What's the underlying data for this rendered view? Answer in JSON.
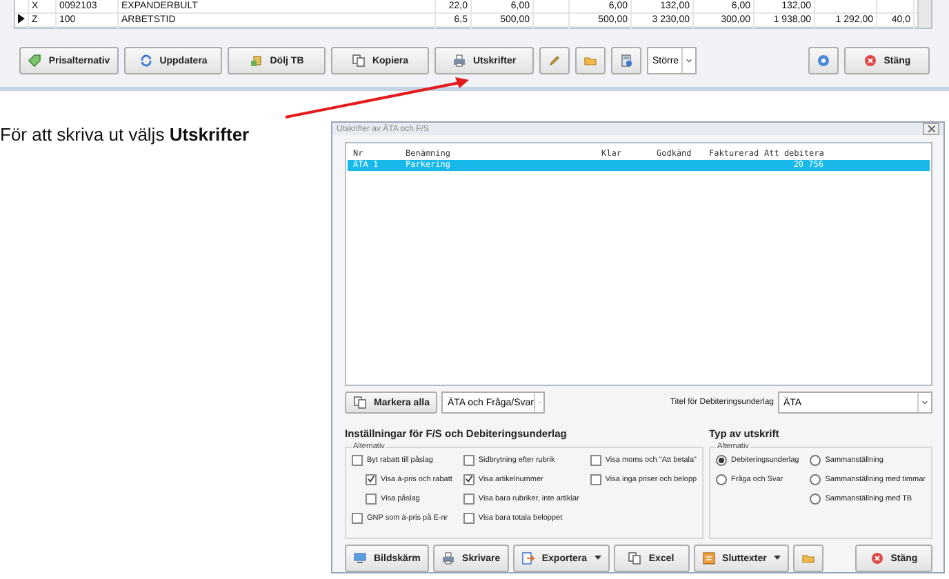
{
  "grid": {
    "rows": [
      {
        "current": false,
        "type": "X",
        "code": "0092103",
        "name": "EXPANDERBULT",
        "cells": [
          "22,0",
          "6,00",
          "",
          "6,00",
          "132,00",
          "6,00",
          "132,00",
          "",
          ""
        ]
      },
      {
        "current": true,
        "type": "Z",
        "code": "100",
        "name": "ARBETSTID",
        "cells": [
          "6,5",
          "500,00",
          "",
          "500,00",
          "3 230,00",
          "300,00",
          "1 938,00",
          "1 292,00",
          "40,0"
        ]
      }
    ]
  },
  "toolbar": {
    "buttons": [
      {
        "kind": "text",
        "label": "Prisalternativ"
      },
      {
        "kind": "text",
        "label": "Uppdatera"
      },
      {
        "kind": "text",
        "label": "Dölj TB"
      },
      {
        "kind": "text",
        "label": "Kopiera"
      },
      {
        "kind": "text",
        "label": "Utskrifter"
      },
      {
        "kind": "icon"
      },
      {
        "kind": "icon"
      },
      {
        "kind": "icon"
      }
    ],
    "size_select": "Större",
    "close": "Stäng"
  },
  "instruction": "För att skriva ut väljs **Utskrifter**",
  "dialog": {
    "title": "Utskrifter av ÄTA och F/S",
    "columns": [
      "Nr",
      "Benämning",
      "Klar",
      "Godkänd",
      "Fakturerad",
      "Att debitera"
    ],
    "rows": [
      {
        "selected": true,
        "cells": [
          "ÄTA 1",
          "Parkering",
          "",
          "",
          "",
          "20 756"
        ]
      }
    ],
    "mark_all": "Markera alla",
    "filter_select": "ÄTA och Fråga/Svar",
    "title_label": "Titel för Debiteringsunderlag",
    "title_select": "ÄTA",
    "settings": {
      "heading": "Inställningar för F/S och Debiteringsunderlag",
      "group": "Alternativ",
      "columns": [
        [
          {
            "label": "Byt rabatt till påslag",
            "checked": false,
            "children": [
              {
                "label": "Visa à-pris och rabatt",
                "checked": true
              },
              {
                "label": "Visa påslag",
                "checked": false
              }
            ]
          },
          {
            "label": "GNP som à-pris på E-nr",
            "checked": false
          }
        ],
        [
          {
            "label": "Sidbrytning efter rubrik",
            "checked": false
          },
          {
            "label": "Visa artikelnummer",
            "checked": true
          },
          {
            "label": "Visa bara rubriker, inte artiklar",
            "checked": false
          },
          {
            "label": "Visa bara totala beloppet",
            "checked": false
          }
        ],
        [
          {
            "label": "Visa moms och \"Att betala\"",
            "checked": false
          },
          {
            "label": "Visa inga priser och belopp",
            "checked": false
          }
        ]
      ]
    },
    "print_type": {
      "heading": "Typ av utskrift",
      "group": "Alternativ",
      "columns": [
        [
          {
            "label": "Debiteringsunderlag",
            "selected": true
          },
          {
            "label": "Fråga och Svar",
            "selected": false
          }
        ],
        [
          {
            "label": "Sammanställning",
            "selected": false
          },
          {
            "label": "Sammanställning med timmar",
            "selected": false
          },
          {
            "label": "Sammanställning med TB",
            "selected": false
          }
        ]
      ]
    },
    "buttons": [
      {
        "label": "Bildskärm",
        "dropdown": false
      },
      {
        "label": "Skrivare",
        "dropdown": false
      },
      {
        "label": "Exportera",
        "dropdown": true
      },
      {
        "label": "Excel",
        "dropdown": false
      },
      {
        "label": "Sluttexter",
        "dropdown": true
      }
    ],
    "close": "Stäng"
  }
}
